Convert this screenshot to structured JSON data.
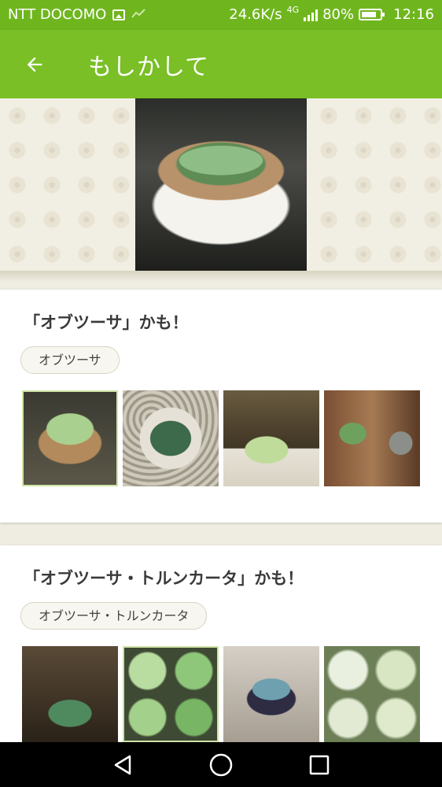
{
  "status_bar": {
    "carrier": "NTT DOCOMO",
    "speed": "24.6K/s",
    "network": "4G",
    "battery": "80%",
    "time": "12:16"
  },
  "app_bar": {
    "title": "もしかして",
    "back_icon": "arrow-left-icon"
  },
  "results": [
    {
      "title": "「オブツーサ」かも！",
      "chip": "オブツーサ"
    },
    {
      "title": "「オブツーサ・トルンカータ」かも！",
      "chip": "オブツーサ・トルンカータ"
    }
  ],
  "colors": {
    "status_bar": "#6fb61e",
    "app_bar": "#79bf25",
    "background": "#efece2"
  }
}
